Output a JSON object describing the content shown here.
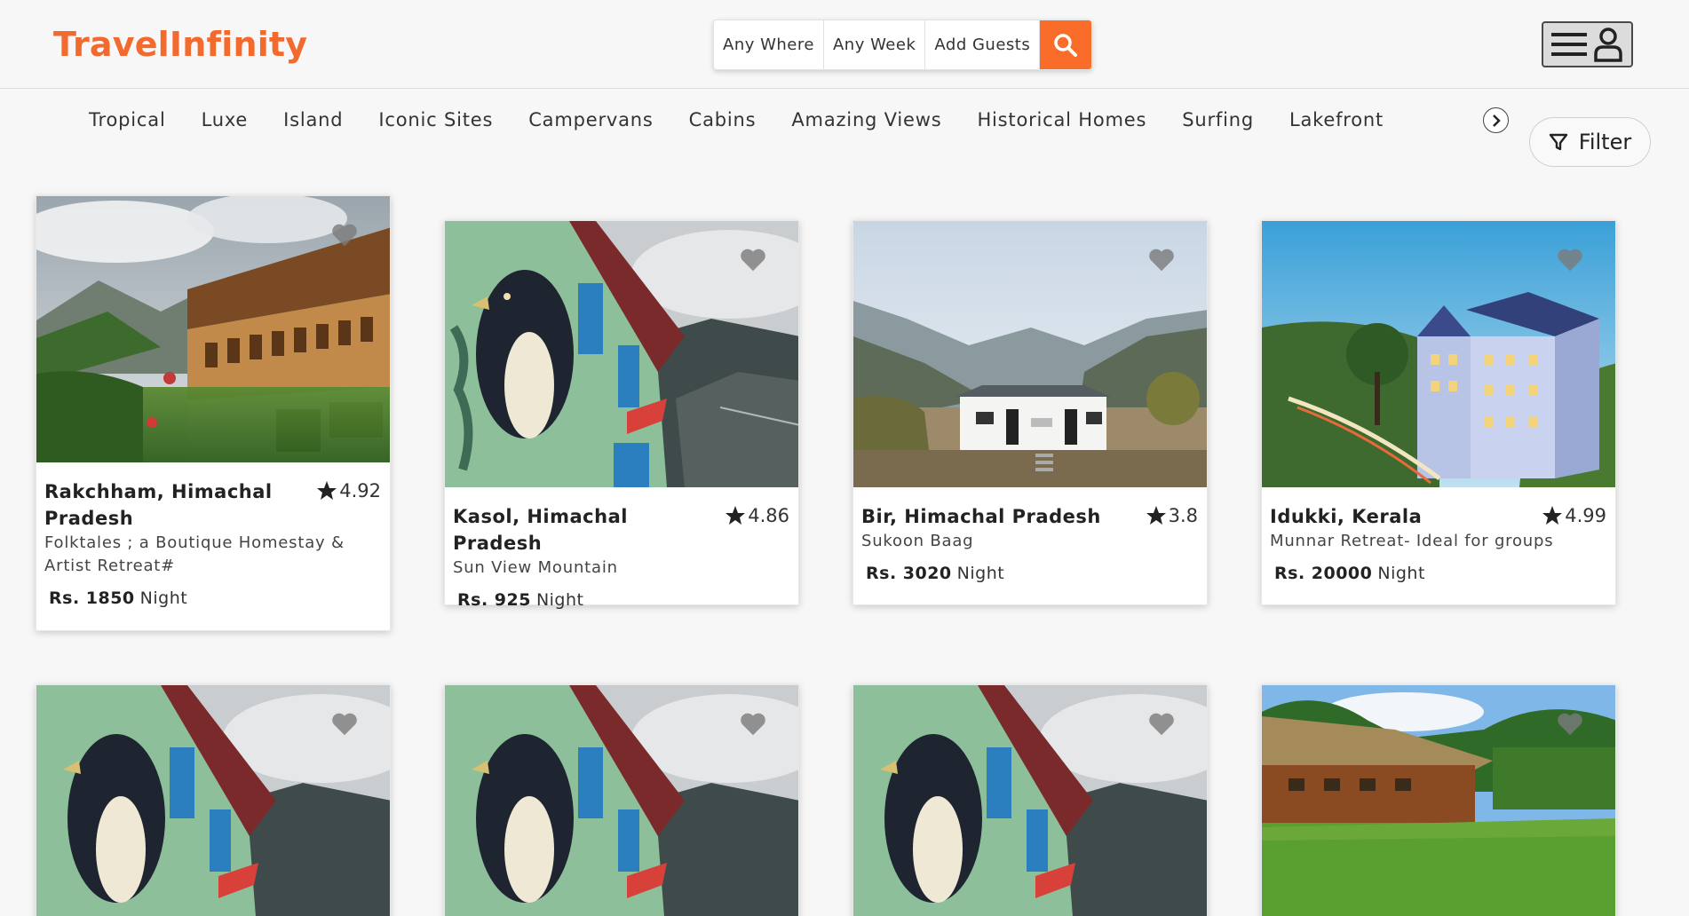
{
  "header": {
    "logo": "TravelInfinity",
    "search": {
      "where": "Any Where",
      "week": "Any Week",
      "guests": "Add Guests"
    }
  },
  "categories": [
    "Tropical",
    "Luxe",
    "Island",
    "Iconic Sites",
    "Campervans",
    "Cabins",
    "Amazing Views",
    "Historical Homes",
    "Surfing",
    "Lakefront"
  ],
  "filter_label": "Filter",
  "colors": {
    "brand": "#f26a2e",
    "search_button": "#f96c2a",
    "heart": "#7a7a7a"
  },
  "listings": [
    {
      "title": "Rakchham, Himachal Pradesh",
      "rating": "4.92",
      "subtitle": "Folktales ; a Boutique Homestay & Artist Retreat#",
      "price": "Rs. 1850",
      "unit": "Night",
      "image": "wooden-house-mountain-photo"
    },
    {
      "title": "Kasol, Himachal Pradesh",
      "rating": "4.86",
      "subtitle": "Sun View Mountain",
      "price": "Rs. 925",
      "unit": "Night",
      "image": "bird-mural-house-photo"
    },
    {
      "title": "Bir, Himachal Pradesh",
      "rating": "3.8",
      "subtitle": "Sukoon Baag",
      "price": "Rs. 3020",
      "unit": "Night",
      "image": "white-cottage-valley-photo"
    },
    {
      "title": "Idukki, Kerala",
      "rating": "4.99",
      "subtitle": "Munnar Retreat- Ideal for groups",
      "price": "Rs. 20000",
      "unit": "Night",
      "image": "hillside-hotel-photo"
    },
    {
      "image": "bird-mural-house-photo"
    },
    {
      "image": "bird-mural-house-photo"
    },
    {
      "image": "bird-mural-house-photo"
    },
    {
      "image": "thatched-hut-lawn-photo"
    }
  ]
}
